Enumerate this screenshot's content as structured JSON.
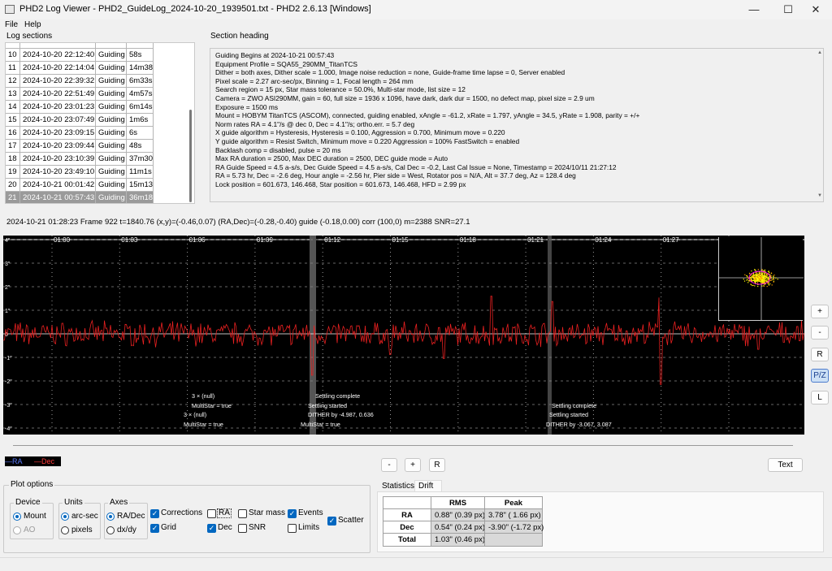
{
  "window": {
    "title": "PHD2 Log Viewer - PHD2_GuideLog_2024-10-20_1939501.txt - PHD2 2.6.13 [Windows]",
    "minimize": "—",
    "maximize": "☐",
    "close": "✕"
  },
  "menu": {
    "file": "File",
    "help": "Help"
  },
  "log_sections": {
    "label": "Log sections",
    "rows": [
      {
        "n": "10",
        "date": "2024-10-20 22:12:40",
        "type": "Guiding",
        "dur": "58s"
      },
      {
        "n": "11",
        "date": "2024-10-20 22:14:04",
        "type": "Guiding",
        "dur": "14m38s"
      },
      {
        "n": "12",
        "date": "2024-10-20 22:39:32",
        "type": "Guiding",
        "dur": "6m33s"
      },
      {
        "n": "13",
        "date": "2024-10-20 22:51:49",
        "type": "Guiding",
        "dur": "4m57s"
      },
      {
        "n": "14",
        "date": "2024-10-20 23:01:23",
        "type": "Guiding",
        "dur": "6m14s"
      },
      {
        "n": "15",
        "date": "2024-10-20 23:07:49",
        "type": "Guiding",
        "dur": "1m6s"
      },
      {
        "n": "16",
        "date": "2024-10-20 23:09:15",
        "type": "Guiding",
        "dur": "6s"
      },
      {
        "n": "17",
        "date": "2024-10-20 23:09:44",
        "type": "Guiding",
        "dur": "48s"
      },
      {
        "n": "18",
        "date": "2024-10-20 23:10:39",
        "type": "Guiding",
        "dur": "37m30s"
      },
      {
        "n": "19",
        "date": "2024-10-20 23:49:10",
        "type": "Guiding",
        "dur": "11m1s"
      },
      {
        "n": "20",
        "date": "2024-10-21 00:01:42",
        "type": "Guiding",
        "dur": "15m13s"
      },
      {
        "n": "21",
        "date": "2024-10-21 00:57:43",
        "type": "Guiding",
        "dur": "36m18s"
      }
    ]
  },
  "section_heading": {
    "label": "Section heading",
    "lines": [
      "Guiding Begins at 2024-10-21 00:57:43",
      "Equipment Profile = SQA55_290MM_TitanTCS",
      "Dither = both axes, Dither scale = 1.000, Image noise reduction = none, Guide-frame time lapse = 0, Server enabled",
      "Pixel scale = 2.27 arc-sec/px, Binning = 1, Focal length = 264 mm",
      "Search region = 15 px, Star mass tolerance = 50.0%, Multi-star mode, list size = 12",
      " Camera = ZWO ASI290MM, gain = 60, full size = 1936 x 1096, have dark, dark dur = 1500, no defect map, pixel size = 2.9 um",
      "Exposure = 1500 ms",
      "Mount = HOBYM TitanTCS (ASCOM), connected, guiding enabled, xAngle = -61.2, xRate = 1.797, yAngle = 34.5, yRate = 1.908, parity = +/+",
      "Norm rates RA = 4.1\"/s @ dec 0, Dec = 4.1\"/s; ortho.err. = 5.7 deg",
      "X guide algorithm = Hysteresis, Hysteresis = 0.100, Aggression = 0.700, Minimum move = 0.220",
      "Y guide algorithm = Resist Switch, Minimum move = 0.220 Aggression = 100% FastSwitch = enabled",
      "Backlash comp = disabled, pulse = 20 ms",
      "Max RA duration = 2500, Max DEC duration = 2500, DEC guide mode = Auto",
      "RA Guide Speed = 4.5 a-s/s, Dec Guide Speed = 4.5 a-s/s, Cal Dec = -0.2, Last Cal Issue = None, Timestamp = 2024/10/11 21:27:12",
      "RA = 5.73 hr, Dec = -2.6 deg, Hour angle = -2.56 hr, Pier side = West, Rotator pos = N/A, Alt = 37.7 deg, Az = 128.4 deg",
      "Lock position = 601.673, 146.468, Star position = 601.673, 146.468, HFD = 2.99 px"
    ]
  },
  "status_line": "2024-10-21 01:28:23 Frame 922 t=1840.76 (x,y)=(-0.46,0.07) (RA,Dec)=(-0.28,-0.40) guide (-0.18,0.00) corr (100,0) m=2388 SNR=27.1",
  "chart_data": {
    "type": "line",
    "x_ticks": [
      "01:00",
      "01:03",
      "01:06",
      "01:09",
      "01:12",
      "01:15",
      "01:18",
      "01:21",
      "01:24",
      "01:27",
      "01:3"
    ],
    "y_ticks": [
      "4\"",
      "3\"",
      "2\"",
      "1\"",
      "0",
      "-1\"",
      "-2\"",
      "-3\"",
      "-4\""
    ],
    "ylim": [
      -4,
      4
    ],
    "grid": true,
    "series": [
      {
        "name": "Dec",
        "color": "#e82020"
      }
    ],
    "events": [
      {
        "text": "3 × (null)"
      },
      {
        "text": "MultiStar = true"
      },
      {
        "text": "3 × (null)"
      },
      {
        "text": "MultiStar = true"
      },
      {
        "text": "Settling complete"
      },
      {
        "text": "Settling started"
      },
      {
        "text": "DITHER by -4.987, 0.636"
      },
      {
        "text": "MultiStar = true"
      },
      {
        "text": "Settling complete"
      },
      {
        "text": "Settling started"
      },
      {
        "text": "DITHER by -3.067, 3.087"
      }
    ]
  },
  "legend": {
    "ra": "—RA",
    "dec": "—Dec"
  },
  "side_buttons": {
    "zoom_in": "+",
    "zoom_out": "-",
    "reset": "R",
    "pz": "P/Z",
    "lock": "L"
  },
  "bottom_buttons": {
    "minus": "-",
    "plus": "+",
    "reset": "R",
    "text": "Text"
  },
  "plot_options": {
    "label": "Plot options",
    "device": {
      "label": "Device",
      "mount": "Mount",
      "ao": "AO"
    },
    "units": {
      "label": "Units",
      "arcsec": "arc-sec",
      "pixels": "pixels"
    },
    "axes": {
      "label": "Axes",
      "radec": "RA/Dec",
      "dxdy": "dx/dy"
    },
    "checks": {
      "corrections": "Corrections",
      "grid": "Grid",
      "ra": "RA",
      "dec": "Dec",
      "star_mass": "Star mass",
      "snr": "SNR",
      "events": "Events",
      "limits": "Limits",
      "scatter": "Scatter"
    }
  },
  "statistics": {
    "tab_stats": "Statistics",
    "tab_drift": "Drift",
    "headers": [
      "RMS",
      "Peak"
    ],
    "rows": [
      {
        "label": "RA",
        "rms": "0.88\" (0.39 px)",
        "peak": "3.78\" ( 1.66 px)"
      },
      {
        "label": "Dec",
        "rms": "0.54\" (0.24 px)",
        "peak": "-3.90\" (-1.72 px)"
      },
      {
        "label": "Total",
        "rms": "1.03\" (0.46 px)",
        "peak": ""
      }
    ]
  }
}
